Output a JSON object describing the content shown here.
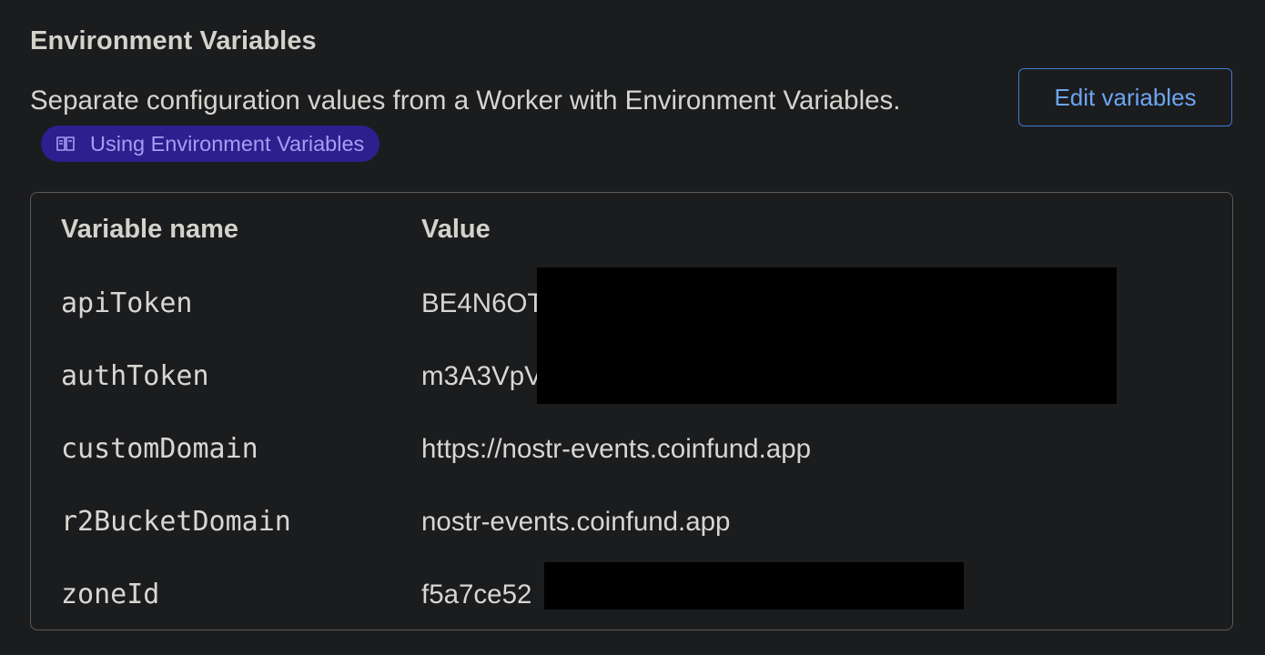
{
  "section": {
    "title": "Environment Variables",
    "description": "Separate configuration values from a Worker with Environment Variables.",
    "doc_link_label": "Using Environment Variables",
    "doc_link_icon": "book-icon",
    "edit_button_label": "Edit variables"
  },
  "table": {
    "headers": {
      "name": "Variable name",
      "value": "Value"
    },
    "rows": [
      {
        "name": "apiToken",
        "value": "BE4N6OT",
        "redacted": true
      },
      {
        "name": "authToken",
        "value": "m3A3VpV",
        "redacted": true
      },
      {
        "name": "customDomain",
        "value": "https://nostr-events.coinfund.app",
        "redacted": false
      },
      {
        "name": "r2BucketDomain",
        "value": "nostr-events.coinfund.app",
        "redacted": false
      },
      {
        "name": "zoneId",
        "value": "f5a7ce52",
        "redacted": true
      }
    ]
  },
  "colors": {
    "background": "#1b1c1e",
    "text": "#d9d6d2",
    "accent_blue": "#6da5f2",
    "pill_bg": "#2e1f8f",
    "pill_text": "#a99bf2",
    "redaction": "#000000"
  }
}
